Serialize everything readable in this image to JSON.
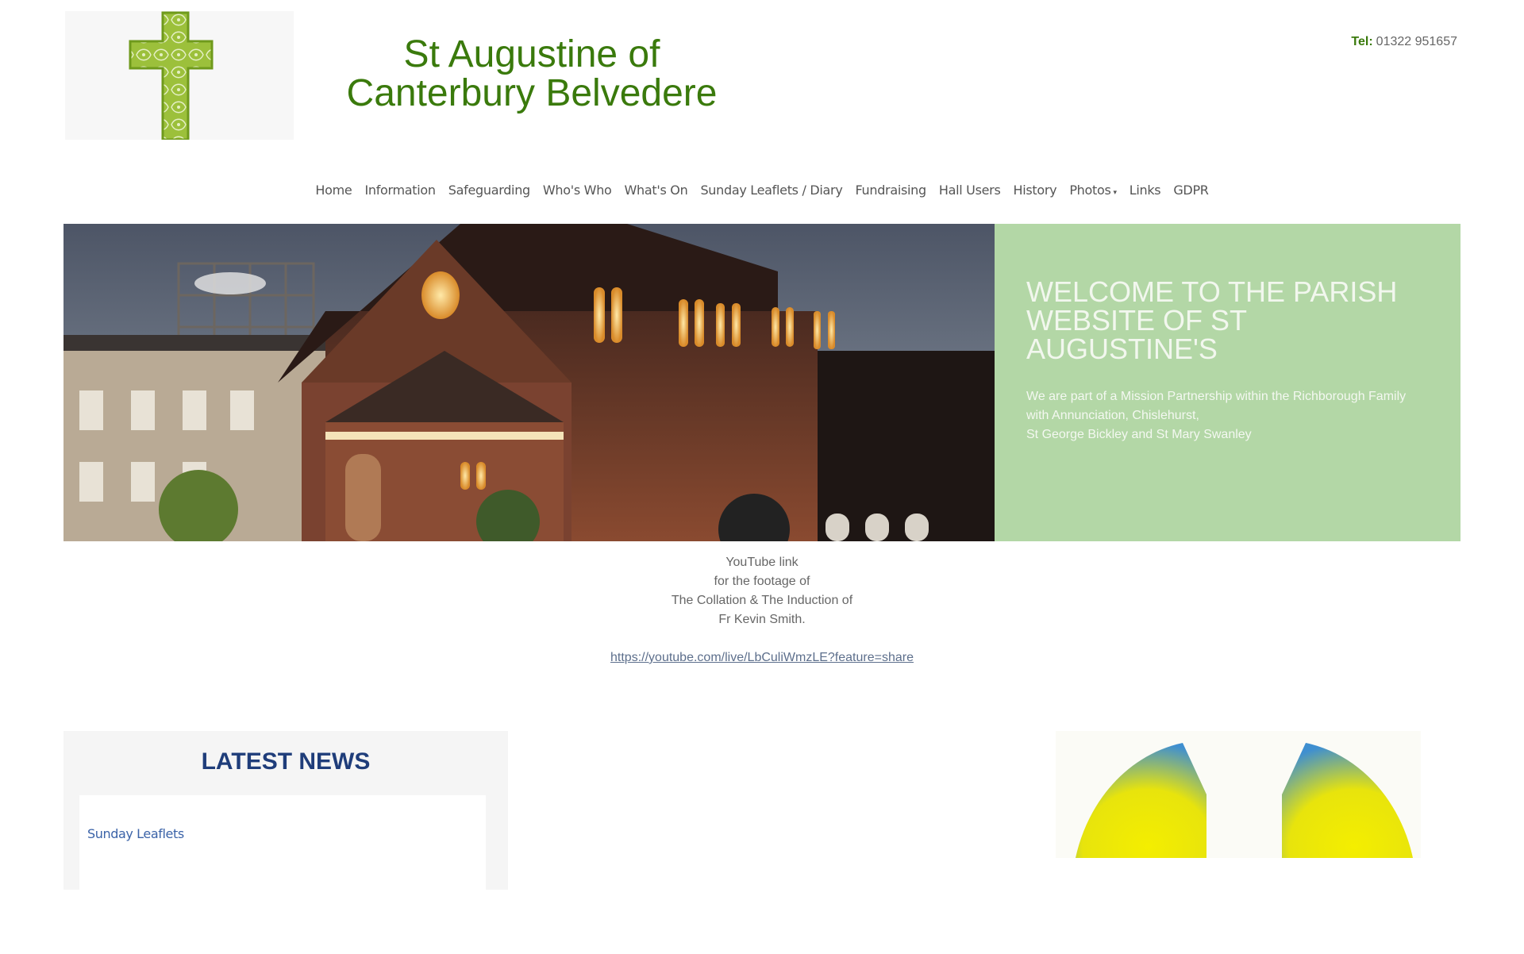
{
  "header": {
    "title_line1": "St Augustine of",
    "title_line2": "Canterbury Belvedere",
    "tel_label": "Tel:",
    "tel_number": "01322 951657"
  },
  "nav": {
    "items": [
      {
        "label": "Home"
      },
      {
        "label": "Information"
      },
      {
        "label": "Safeguarding"
      },
      {
        "label": "Who's Who"
      },
      {
        "label": "What's On"
      },
      {
        "label": "Sunday Leaflets / Diary"
      },
      {
        "label": "Fundraising"
      },
      {
        "label": "Hall Users"
      },
      {
        "label": "History"
      },
      {
        "label": "Photos",
        "caret": "▾"
      },
      {
        "label": "Links"
      },
      {
        "label": "GDPR"
      }
    ]
  },
  "hero": {
    "heading": "WELCOME TO THE PARISH WEBSITE OF ST AUGUSTINE'S",
    "text_line1": "We are part of a Mission Partnership within the Richborough Family",
    "text_line2": "with Annunciation, Chislehurst,",
    "text_line3": "St George Bickley and St Mary Swanley"
  },
  "youtube": {
    "line1": "YouTube link",
    "line2": "for the footage of",
    "line3": "The Collation & The Induction of",
    "line4": "Fr Kevin Smith.",
    "link": "https://youtube.com/live/LbCuliWmzLE?feature=share"
  },
  "news": {
    "title": "LATEST NEWS",
    "first_item": "Sunday Leaflets"
  },
  "colors": {
    "brand_green": "#3a7a0c",
    "hero_panel": "#b3d7a6",
    "news_title": "#1f3d7a",
    "link_blue": "#3b63a8"
  },
  "icons": [
    "cross-logo-icon",
    "church-photo",
    "emblem-logo-icon"
  ]
}
